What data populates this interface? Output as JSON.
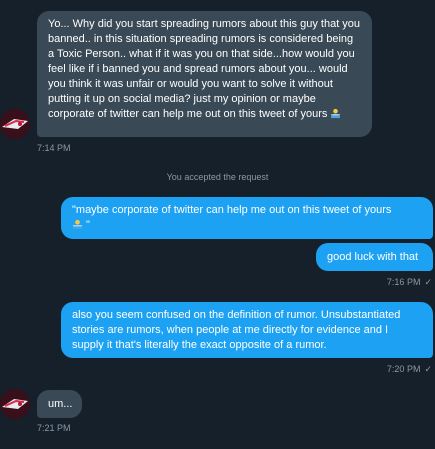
{
  "conversation": {
    "messages": [
      {
        "direction": "incoming",
        "text": "Yo... Why did you start spreading rumors about this guy that you banned..  in this situation spreading rumors is considered being a Toxic Person.. what if it was you on that side...how would you feel like if i banned you and spread rumors about you... would you think it was unfair or would you want to solve it without putting it up on social media? just my opinion or maybe corporate of twitter can help me out on this tweet of yours",
        "emoji": "person-emoji",
        "time": "7:14 PM"
      },
      {
        "direction": "system",
        "text": "You accepted the request"
      },
      {
        "direction": "outgoing",
        "text": "\"maybe corporate of twitter can help me out on this tweet of yours",
        "text_after_emoji": " \""
      },
      {
        "direction": "outgoing",
        "text": "good luck with that",
        "time": "7:16 PM"
      },
      {
        "direction": "outgoing",
        "text": "also you seem confused on the definition of rumor. Unsubstantiated stories are rumors, when people at me directly for evidence and I supply it that's literally the exact opposite of a rumor.",
        "time": "7:20 PM"
      },
      {
        "direction": "incoming",
        "text": "um...",
        "time": "7:21 PM"
      }
    ],
    "status_icon": "check-icon",
    "colors": {
      "background": "#15202b",
      "incoming_bubble": "#394955",
      "outgoing_bubble": "#1da1f2",
      "meta_text": "#8899a6"
    }
  }
}
